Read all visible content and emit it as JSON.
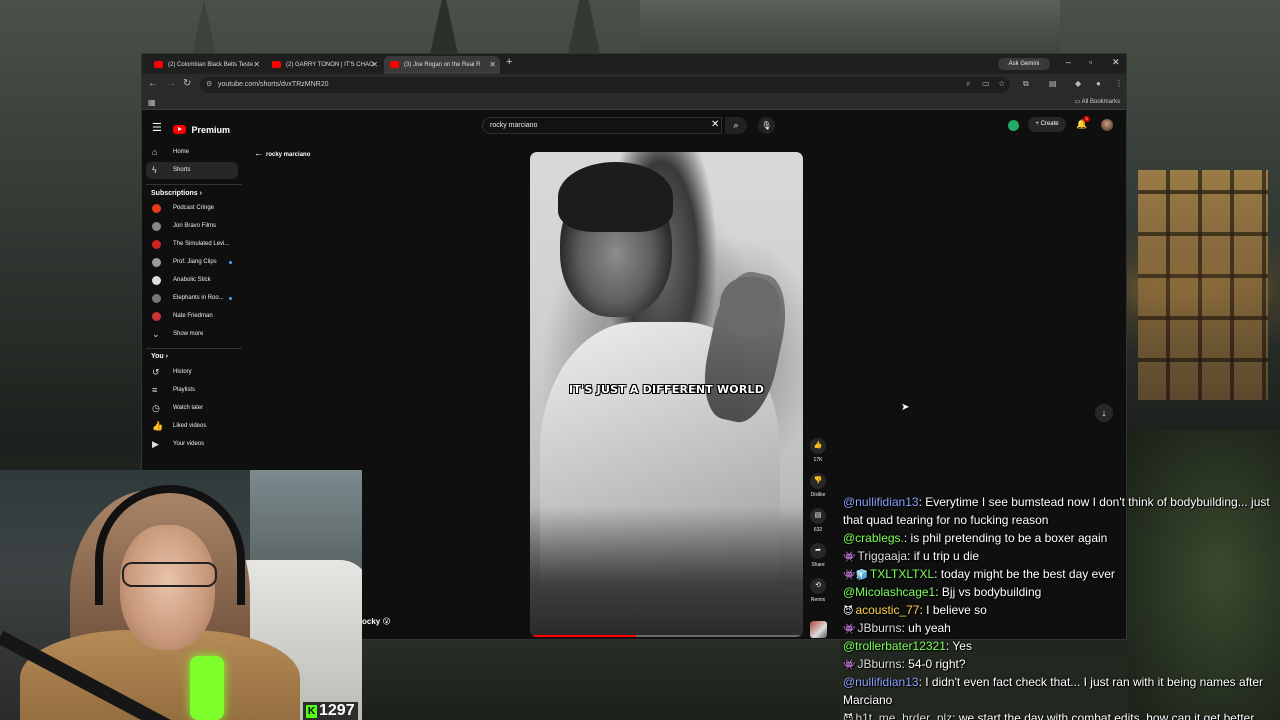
{
  "browser": {
    "tabs": [
      {
        "title": "(2) Colombian Black Belts Teste",
        "active": false
      },
      {
        "title": "(2) GARRY TONON | IT'S CHAO",
        "active": false
      },
      {
        "title": "(3) Joe Rogan on the Real R",
        "active": true
      }
    ],
    "new_tab": "+",
    "ask_gemini": "Ask Gemini",
    "url": "youtube.com/shorts/dvxTRzMNR20",
    "all_bookmarks": "All Bookmarks"
  },
  "youtube": {
    "logo_text": "Premium",
    "search_value": "rocky marciano",
    "create_label": "Create",
    "notifications_count": "3",
    "nav": [
      {
        "label": "Home",
        "icon": "home-icon",
        "active": false
      },
      {
        "label": "Shorts",
        "icon": "shorts-icon",
        "active": true
      }
    ],
    "subscriptions_heading": "Subscriptions",
    "subscriptions": [
      {
        "label": "Podcast Cringe",
        "color": "#e23b1a",
        "dot": false
      },
      {
        "label": "Jon Bravo Films",
        "color": "#888888",
        "dot": false
      },
      {
        "label": "The Simulated Levi...",
        "color": "#cc2222",
        "dot": false
      },
      {
        "label": "Prof. Jiang Clips",
        "color": "#9a9a9a",
        "dot": true
      },
      {
        "label": "Anabolic Stick",
        "color": "#dddddd",
        "dot": false
      },
      {
        "label": "Elephants in Roo...",
        "color": "#777777",
        "dot": true
      },
      {
        "label": "Nate Friedman",
        "color": "#cc3333",
        "dot": false
      }
    ],
    "show_more": "Show more",
    "you_heading": "You",
    "you_items": [
      {
        "label": "History",
        "icon": "history-icon"
      },
      {
        "label": "Playlists",
        "icon": "playlists-icon"
      },
      {
        "label": "Watch later",
        "icon": "watch-later-icon"
      },
      {
        "label": "Liked videos",
        "icon": "liked-videos-icon"
      },
      {
        "label": "Your videos",
        "icon": "your-videos-icon"
      }
    ],
    "back_label": "rocky marciano",
    "video": {
      "caption": "IT'S JUST A DIFFERENT WORLD",
      "progress": 0.39
    },
    "actions": {
      "like_count": "17K",
      "dislike_label": "Dislike",
      "comment_count": "632",
      "share_label": "Share",
      "remix_label": "Remix"
    }
  },
  "stream": {
    "sub_count": "1297",
    "sub_icon": "K",
    "overlay_text": "ocky 😮",
    "chat": [
      {
        "badge": "",
        "user": "@nullifidian13",
        "color": "#8aa0ff",
        "text": "Everytime I see bumstead now I don't think of bodybuilding... just that quad tearing for no fucking reason"
      },
      {
        "badge": "",
        "user": "@crablegs.",
        "color": "#7dff5a",
        "text": "is phil pretending to be a boxer again"
      },
      {
        "badge": "👾",
        "user": "Triggaaja",
        "color": "#dcdcdc",
        "text": "if u trip u die"
      },
      {
        "badge": "👾🧊",
        "user": "TXLTXLTXL",
        "color": "#7dff5a",
        "text": "today might be the best day ever"
      },
      {
        "badge": "",
        "user": "@Micolashcage1",
        "color": "#7dff5a",
        "text": "Bjj vs bodybuilding"
      },
      {
        "badge": "😈",
        "user": "acoustic_77",
        "color": "#ffd54a",
        "text": "I believe so"
      },
      {
        "badge": "👾",
        "user": "JBburns",
        "color": "#dcdcdc",
        "text": "uh yeah"
      },
      {
        "badge": "",
        "user": "@trollerbater12321",
        "color": "#7dff5a",
        "text": "Yes"
      },
      {
        "badge": "👾",
        "user": "JBburns",
        "color": "#dcdcdc",
        "text": "54-0 right?"
      },
      {
        "badge": "",
        "user": "@nullifidian13",
        "color": "#8aa0ff",
        "text": "I didn't even fact check that... I just ran with it being names after Marciano"
      },
      {
        "badge": "😈",
        "user": "h1t_me_hrder_plz",
        "color": "#dcdcdc",
        "text": "we start the day with combat edits, how can it get better"
      }
    ]
  }
}
